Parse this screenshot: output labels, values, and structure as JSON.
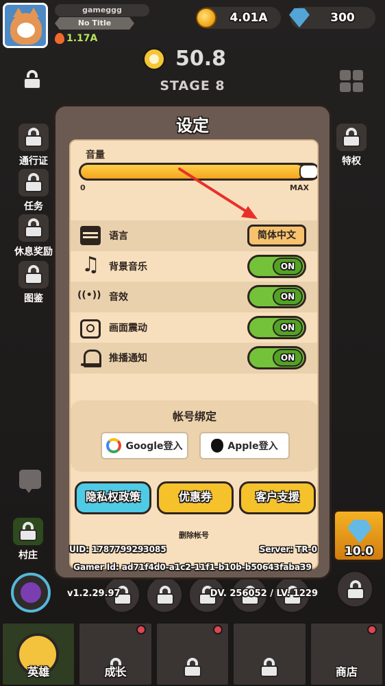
{
  "player": {
    "name": "gameggg",
    "title": "No Title",
    "power": "1.17A"
  },
  "resources": {
    "coins": "4.01A",
    "gems": "300"
  },
  "timer": {
    "value": "50.8",
    "stage": "STAGE 8"
  },
  "sidebar_left": [
    {
      "label": "通行证",
      "icon": "lock-icon"
    },
    {
      "label": "任务",
      "icon": "lock-icon"
    },
    {
      "label": "休息奖励",
      "icon": "lock-icon"
    },
    {
      "label": "图鉴",
      "icon": "lock-icon"
    }
  ],
  "sidebar_right": [
    {
      "label": "特权",
      "icon": "lock-icon"
    }
  ],
  "village": {
    "label": "村庄"
  },
  "gem_shop": {
    "value": "10.0"
  },
  "bottom_status": {
    "version": "v1.2.29.97",
    "dv_lv": "DV. 256052 / LV. 1229"
  },
  "nav": [
    {
      "label": "英雄",
      "badge": false
    },
    {
      "label": "成长",
      "badge": true
    },
    {
      "label": "",
      "badge": true
    },
    {
      "label": "",
      "badge": false
    },
    {
      "label": "商店",
      "badge": true
    }
  ],
  "settings": {
    "title": "设定",
    "volume": {
      "label": "音量",
      "min": "0",
      "max": "MAX",
      "level": 0.94
    },
    "rows": [
      {
        "icon": "chat-icon",
        "label": "语言",
        "control": "button",
        "value": "简体中文"
      },
      {
        "icon": "music-icon",
        "label": "背景音乐",
        "control": "toggle",
        "value": "ON"
      },
      {
        "icon": "sound-icon",
        "label": "音效",
        "control": "toggle",
        "value": "ON"
      },
      {
        "icon": "vibration-icon",
        "label": "画面震动",
        "control": "toggle",
        "value": "ON"
      },
      {
        "icon": "bell-icon",
        "label": "推播通知",
        "control": "toggle",
        "value": "ON"
      }
    ],
    "account": {
      "header": "帐号绑定",
      "google_label": "Google登入",
      "apple_label": "Apple登入"
    },
    "buttons": {
      "privacy": "隐私权政策",
      "coupon": "优惠券",
      "support": "客户支援"
    },
    "delete_account": "删除帐号",
    "uid": "UID: 1787799293085",
    "server": "Server: TR-0",
    "gamer_id": "Gamer Id: ad71f4d0-a1c2-11f1-b10b-b50643faba39"
  },
  "colors": {
    "panel": "#6b5a51",
    "panel_inner": "#f7dfbd",
    "toggle_on": "#74c23a",
    "privacy_btn": "#4fcbe6",
    "coupon_btn": "#f6c22c",
    "support_btn": "#f6c22c",
    "arrow": "#e8302a"
  }
}
